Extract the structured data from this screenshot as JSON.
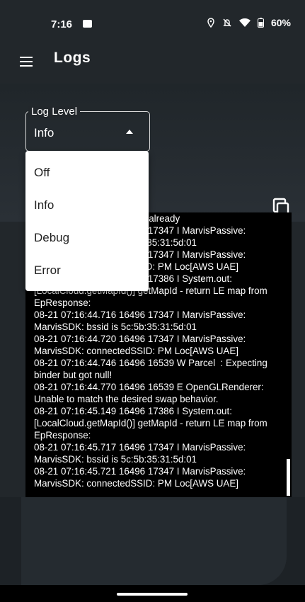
{
  "status": {
    "time": "7:16",
    "battery": "60%",
    "icons": [
      "location-icon",
      "mute-icon",
      "wifi-icon",
      "battery-icon"
    ]
  },
  "app_bar": {
    "title": "Logs"
  },
  "log_level": {
    "label": "Log Level",
    "value": "Info",
    "options": [
      "Off",
      "Info",
      "Debug",
      "Error"
    ]
  },
  "logs": [
    "                   nt receiver has already",
    "08-21 07:16:44.716 16496 17347 I MarvisPassive: MarvisSDK: bssid is 5c:5b:35:31:5d:01",
    "08-21 07:16:44.716 16496 17347 I MarvisPassive: MarvisSDK: connectedSSID: PM Loc[AWS UAE]",
    "08-21 07:16:44.199 16496 17386 I System.out: [LocalCloud.getMapId()] getMapId - return LE map from EpResponse:",
    "08-21 07:16:44.716 16496 17347 I MarvisPassive: MarvisSDK: bssid is 5c:5b:35:31:5d:01",
    "08-21 07:16:44.720 16496 17347 I MarvisPassive: MarvisSDK: connectedSSID: PM Loc[AWS UAE]",
    "08-21 07:16:44.746 16496 16539 W Parcel  : Expecting binder but got null!",
    "08-21 07:16:44.770 16496 16539 E OpenGLRenderer: Unable to match the desired swap behavior.",
    "08-21 07:16:45.149 16496 17386 I System.out: [LocalCloud.getMapId()] getMapId - return LE map from EpResponse:",
    "08-21 07:16:45.717 16496 17347 I MarvisPassive: MarvisSDK: bssid is 5c:5b:35:31:5d:01",
    "08-21 07:16:45.721 16496 17347 I MarvisPassive: MarvisSDK: connectedSSID: PM Loc[AWS UAE]"
  ]
}
